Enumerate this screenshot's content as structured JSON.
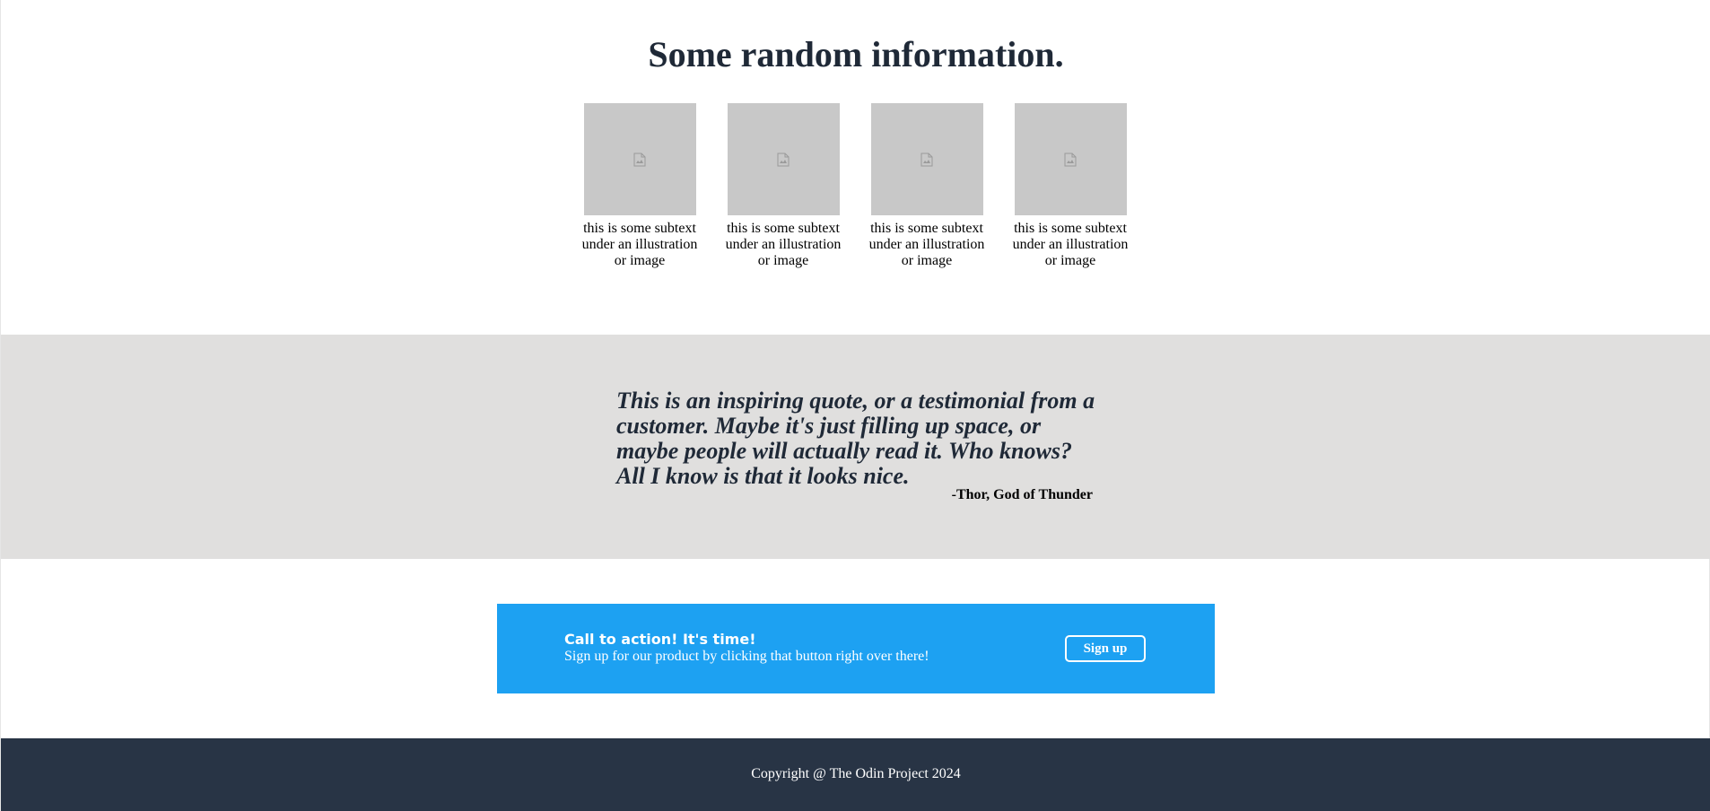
{
  "info": {
    "title": "Some random information.",
    "cards": [
      {
        "image_icon": "broken-image-icon",
        "caption": "this is some subtext under an illustration or image"
      },
      {
        "image_icon": "broken-image-icon",
        "caption": "this is some subtext under an illustration or image"
      },
      {
        "image_icon": "broken-image-icon",
        "caption": "this is some subtext under an illustration or image"
      },
      {
        "image_icon": "broken-image-icon",
        "caption": "this is some subtext under an illustration or image"
      }
    ]
  },
  "quote": {
    "text": "This is an inspiring quote, or a testimonial from a customer. Maybe it's just filling up space, or maybe people will actually read it. Who knows? All I know is that it looks nice.",
    "author": "-Thor, God of Thunder"
  },
  "cta": {
    "heading": "Call to action! It's time!",
    "subtext": "Sign up for our product by clicking that button right over there!",
    "button_label": "Sign up"
  },
  "footer": {
    "text": "Copyright @ The Odin Project 2024"
  },
  "colors": {
    "heading": "#1f2937",
    "quote_bg": "#e0dfde",
    "cta_bg": "#1da1f2",
    "footer_bg": "#283445",
    "image_placeholder": "#c8c8c8"
  }
}
